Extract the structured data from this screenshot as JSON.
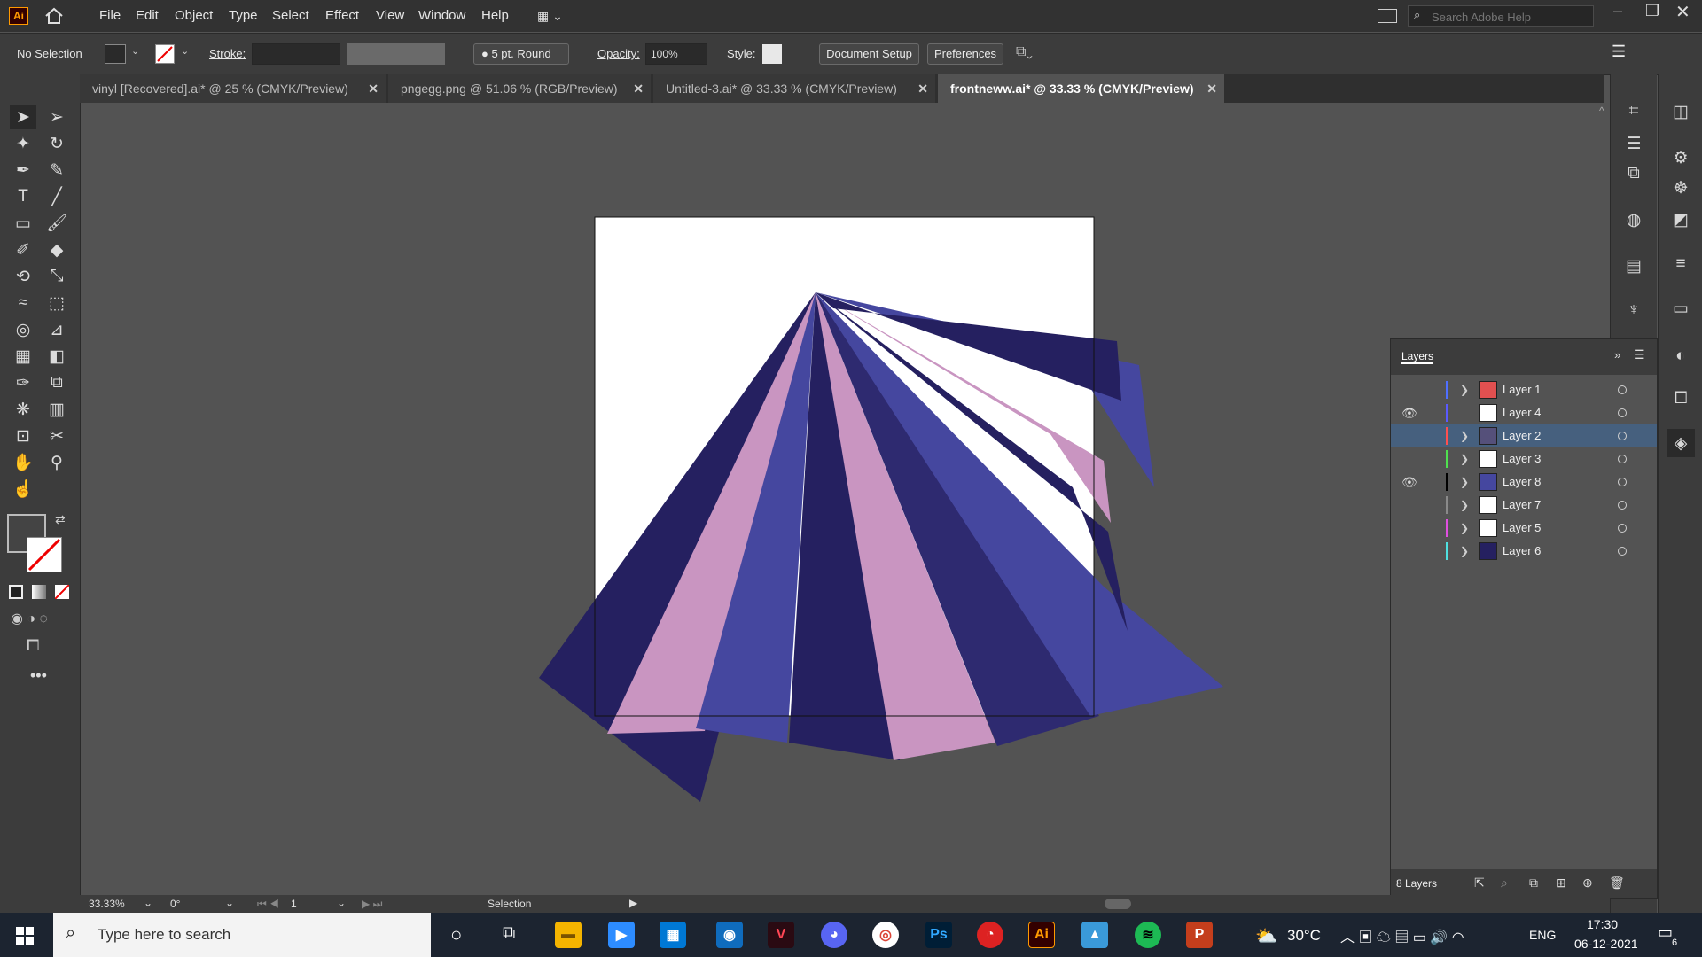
{
  "app": {
    "logo": "Ai"
  },
  "menu": [
    "File",
    "Edit",
    "Object",
    "Type",
    "Select",
    "Effect",
    "View",
    "Window",
    "Help"
  ],
  "search": {
    "placeholder": "Search Adobe Help"
  },
  "control_bar": {
    "selection": "No Selection",
    "stroke_label": "Stroke:",
    "brush": "5 pt. Round",
    "opacity_label": "Opacity:",
    "opacity": "100%",
    "style_label": "Style:",
    "document_setup": "Document Setup",
    "preferences": "Preferences"
  },
  "tabs": [
    {
      "label": "vinyl [Recovered].ai* @ 25 % (CMYK/Preview)",
      "active": false
    },
    {
      "label": "pngegg.png @ 51.06 % (RGB/Preview)",
      "active": false
    },
    {
      "label": "Untitled-3.ai* @ 33.33 % (CMYK/Preview)",
      "active": false
    },
    {
      "label": "frontneww.ai* @ 33.33 % (CMYK/Preview)",
      "active": true
    }
  ],
  "layers_panel": {
    "title": "Layers",
    "count": "8 Layers",
    "layers": [
      {
        "name": "Layer 1",
        "color": "#4f6fff",
        "visible": false,
        "selected": false
      },
      {
        "name": "Layer 4",
        "color": "#5a5aff",
        "visible": true,
        "selected": false
      },
      {
        "name": "Layer 2",
        "color": "#ff4f4f",
        "visible": false,
        "selected": true
      },
      {
        "name": "Layer 3",
        "color": "#4fe04f",
        "visible": false,
        "selected": false
      },
      {
        "name": "Layer 8",
        "color": "#000000",
        "visible": true,
        "selected": false
      },
      {
        "name": "Layer 7",
        "color": "#8a8a8a",
        "visible": false,
        "selected": false
      },
      {
        "name": "Layer 5",
        "color": "#e04fe0",
        "visible": false,
        "selected": false
      },
      {
        "name": "Layer 6",
        "color": "#4fe0e0",
        "visible": false,
        "selected": false
      }
    ]
  },
  "status_bar": {
    "zoom": "33.33%",
    "rotation": "0°",
    "artboard": "1",
    "tool": "Selection"
  },
  "taskbar": {
    "search_placeholder": "Type here to search",
    "weather": "30°C",
    "language": "ENG",
    "time": "17:30",
    "date": "06-12-2021",
    "notifications": "6"
  },
  "artwork_colors": {
    "navy": "#252060",
    "blue": "#45479f",
    "pink": "#c995c1",
    "indigo": "#2e2a70"
  }
}
